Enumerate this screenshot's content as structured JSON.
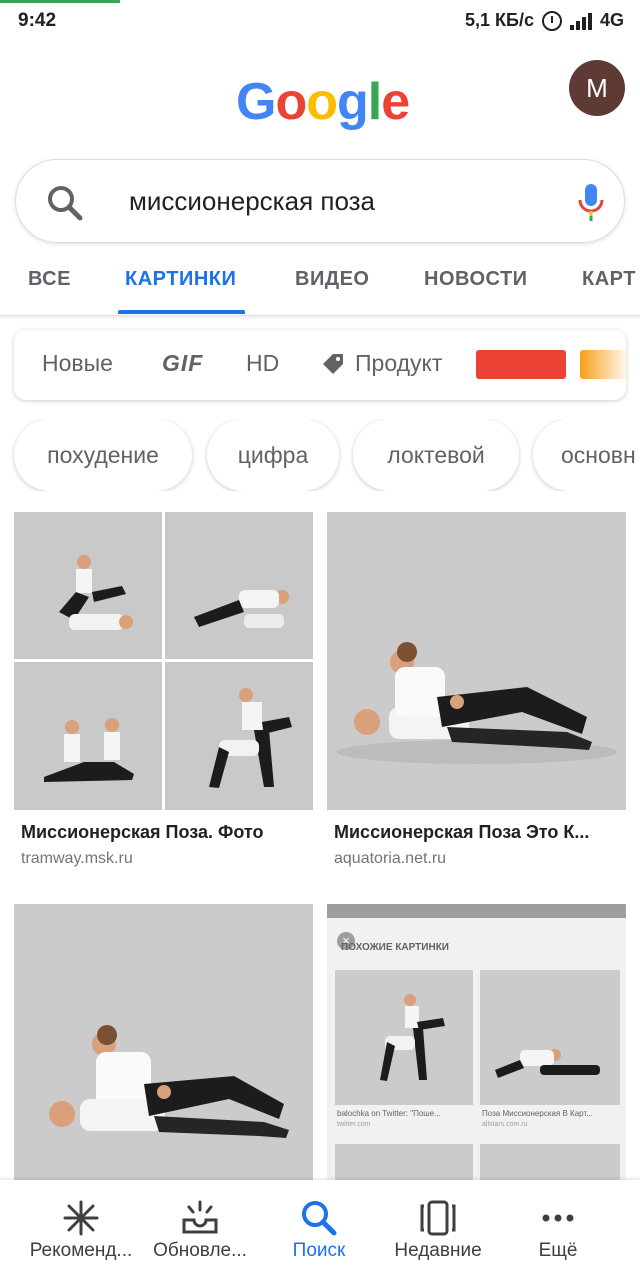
{
  "status_bar": {
    "time": "9:42",
    "speed": "5,1 КБ/с",
    "network": "4G"
  },
  "header": {
    "logo": [
      "G",
      "o",
      "o",
      "g",
      "l",
      "e"
    ],
    "avatar_letter": "M"
  },
  "search": {
    "query": "миссионерская поза"
  },
  "tabs": [
    {
      "label": "ВСЕ",
      "active": false
    },
    {
      "label": "КАРТИНКИ",
      "active": true
    },
    {
      "label": "ВИДЕО",
      "active": false
    },
    {
      "label": "НОВОСТИ",
      "active": false
    },
    {
      "label": "КАРТ",
      "active": false
    }
  ],
  "filters": {
    "new": "Новые",
    "gif": "GIF",
    "hd": "HD",
    "product": "Продукт",
    "color_swatches": [
      "#ea4335",
      "#f6a01a"
    ]
  },
  "chips": [
    "похудение",
    "цифра",
    "локтевой",
    "основн"
  ],
  "results": [
    {
      "title": "Миссионерская Поза. Фото",
      "source": "tramway.msk.ru"
    },
    {
      "title": "Миссионерская Поза Это К...",
      "source": "aquatoria.net.ru"
    }
  ],
  "embedded_screenshot": {
    "heading": "ПОХОЖИЕ КАРТИНКИ",
    "items": [
      {
        "caption": "balochka on Twitter: \"Поше...",
        "source": "twitter.com"
      },
      {
        "caption": "Поза Миссионерская В Карт...",
        "source": "allstars.com.ru"
      }
    ]
  },
  "bottom_nav": [
    {
      "label": "Рекоменд...",
      "icon": "asterisk-icon",
      "active": false
    },
    {
      "label": "Обновле...",
      "icon": "updates-tray-icon",
      "active": false
    },
    {
      "label": "Поиск",
      "icon": "search-icon",
      "active": true
    },
    {
      "label": "Недавние",
      "icon": "recent-cards-icon",
      "active": false
    },
    {
      "label": "Ещё",
      "icon": "more-dots-icon",
      "active": false
    }
  ],
  "colors": {
    "accent": "#1a73e8",
    "avatar_bg": "#5d3a33",
    "progress": "#34a853"
  }
}
